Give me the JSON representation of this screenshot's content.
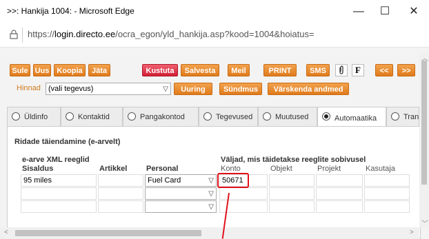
{
  "window": {
    "title": ">>: Hankija 1004: - Microsoft Edge",
    "minimize": "—",
    "maximize": "☐",
    "close": "✕"
  },
  "address": {
    "url_prefix": "https://",
    "url_host": "login.directo.ee",
    "url_path": "/ocra_egon/yld_hankija.asp?kood=1004&hoiatus="
  },
  "toolbar": {
    "buttons": [
      "Sule",
      "Uus",
      "Koopia",
      "Jäta",
      "Kustuta",
      "Salvesta",
      "Meil",
      "PRINT",
      "SMS",
      "<<",
      ">>"
    ],
    "f_label": "F"
  },
  "row2": {
    "hinnad_label": "Hinnad",
    "tegevus_value": "(vali tegevus)",
    "uuring": "Uuring",
    "syndmus": "Sündmus",
    "varskenda": "Värskenda andmed"
  },
  "tabs": [
    {
      "label": "Üldinfo",
      "active": false
    },
    {
      "label": "Kontaktid",
      "active": false
    },
    {
      "label": "Pangakontod",
      "active": false
    },
    {
      "label": "Tegevused",
      "active": false
    },
    {
      "label": "Muutused",
      "active": false
    },
    {
      "label": "Automaatika",
      "active": true
    },
    {
      "label": "Tran",
      "active": false
    }
  ],
  "section": {
    "title": "Ridade täiendamine (e-arvelt)",
    "group1": "e-arve XML reeglid",
    "group2": "Väljad, mis täidetakse reeglite sobivusel",
    "columns": [
      "Sisaldus",
      "Artikkel",
      "Personal",
      "Konto",
      "Objekt",
      "Projekt",
      "Kasutaja"
    ],
    "rows": [
      {
        "sisaldus": "95 miles",
        "artikkel": "",
        "personal": "Fuel Card",
        "konto": "50671",
        "objekt": "",
        "projekt": "",
        "kasutaja": ""
      },
      {
        "sisaldus": "",
        "artikkel": "",
        "personal": "",
        "konto": "",
        "objekt": "",
        "projekt": "",
        "kasutaja": ""
      },
      {
        "sisaldus": "",
        "artikkel": "",
        "personal": "",
        "konto": "",
        "objekt": "",
        "projekt": "",
        "kasutaja": ""
      }
    ]
  },
  "colors": {
    "orange_button": "#e07b1b",
    "red_button": "#d11f35",
    "highlight": "#e0101a"
  }
}
